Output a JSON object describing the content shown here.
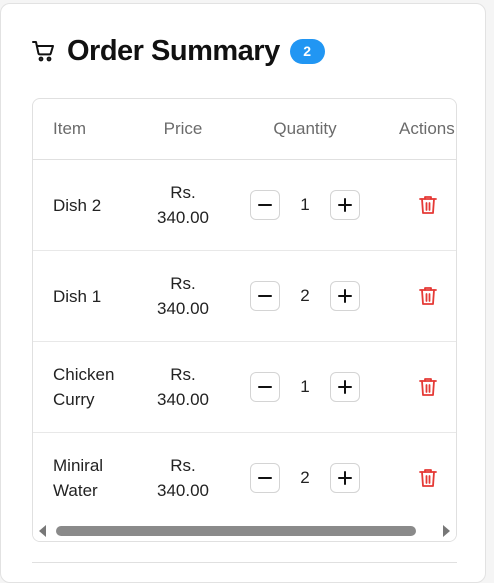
{
  "header": {
    "title": "Order Summary",
    "count": "2",
    "icon": "cart-icon",
    "badge_color": "#2196f3"
  },
  "table": {
    "columns": [
      "Item",
      "Price",
      "Quantity",
      "Actions"
    ],
    "rows": [
      {
        "item": "Dish 2",
        "price_currency": "Rs.",
        "price_amount": "340.00",
        "quantity": "1"
      },
      {
        "item": "Dish 1",
        "price_currency": "Rs.",
        "price_amount": "340.00",
        "quantity": "2"
      },
      {
        "item": "Chicken Curry",
        "price_currency": "Rs.",
        "price_amount": "340.00",
        "quantity": "1"
      },
      {
        "item": "Miniral Water",
        "price_currency": "Rs.",
        "price_amount": "340.00",
        "quantity": "2"
      }
    ],
    "icons": {
      "decrease": "minus-icon",
      "increase": "plus-icon",
      "remove": "trash-icon"
    },
    "delete_color": "#e53935"
  }
}
